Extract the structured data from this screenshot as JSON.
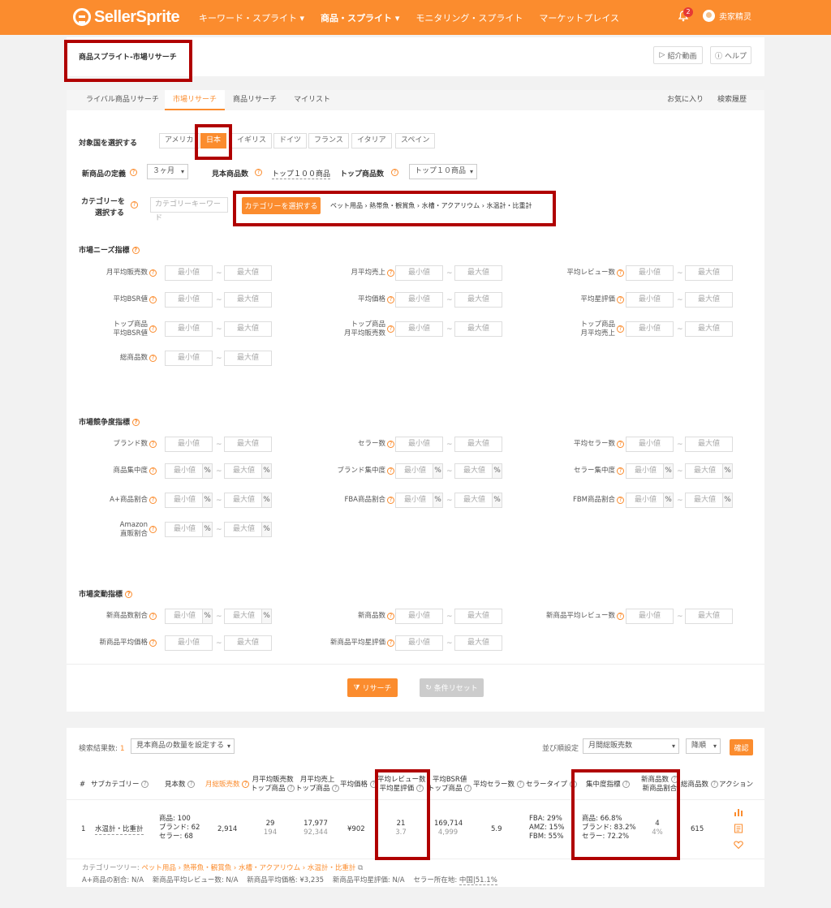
{
  "header": {
    "logo": "SellerSprite",
    "nav": [
      "キーワード・スプライト",
      "商品・スプライト",
      "モニタリング・スプライト",
      "マーケットプレイス"
    ],
    "notification_count": "2",
    "user_name": "卖家精灵"
  },
  "page": {
    "title": "商品スプライト-市場リサーチ",
    "intro_video": "紹介動画",
    "help": "ヘルプ"
  },
  "tabs": [
    "ライバル商品リサーチ",
    "市場リサーチ",
    "商品リサーチ",
    "マイリスト"
  ],
  "tabs_right": [
    "お気に入り",
    "検索履歴"
  ],
  "filters": {
    "country_label": "対象国を選択する",
    "countries": [
      "アメリカ",
      "日本",
      "イギリス",
      "ドイツ",
      "フランス",
      "イタリア",
      "スペイン"
    ],
    "new_product_label": "新商品の定義",
    "new_product_value": "３ヶ月",
    "sample_label": "見本商品数",
    "sample_value": "トップ１００商品",
    "top_label": "トップ商品数",
    "top_value": "トップ１０商品",
    "category_label_1": "カテゴリーを",
    "category_label_2": "選択する",
    "category_keyword_placeholder": "カテゴリーキーワード",
    "category_button": "カテゴリーを選択する",
    "category_path": "ペット用品 › 熱帯魚・観賞魚 › 水槽・アクアリウム › 水温計・比重計",
    "min": "最小値",
    "max": "最大値",
    "tilde": "~",
    "percent": "%"
  },
  "sections": {
    "demand": "市場ニーズ指標",
    "competition": "市場競争度指標",
    "change": "市場変動指標"
  },
  "demand_fields": {
    "c1": [
      "月平均販売数",
      "平均BSR値",
      "トップ商品\n平均BSR値",
      "総商品数"
    ],
    "c2": [
      "月平均売上",
      "平均価格",
      "トップ商品\n月平均販売数"
    ],
    "c3": [
      "平均レビュー数",
      "平均星評価",
      "トップ商品\n月平均売上"
    ]
  },
  "competition_fields": {
    "c1": [
      "ブランド数",
      "商品集中度",
      "A+商品割合",
      "Amazon\n直販割合"
    ],
    "c2": [
      "セラー数",
      "ブランド集中度",
      "FBA商品割合"
    ],
    "c3": [
      "平均セラー数",
      "セラー集中度",
      "FBM商品割合"
    ]
  },
  "change_fields": {
    "c1": [
      "新商品数割合",
      "新商品平均価格"
    ],
    "c2": [
      "新商品数",
      "新商品平均星評価"
    ],
    "c3": [
      "新商品平均レビュー数"
    ]
  },
  "actions": {
    "search": "リサーチ",
    "reset": "条件リセット"
  },
  "results": {
    "count_label": "検索結果数:",
    "count": "1",
    "sample_select": "見本商品の数量を設定する",
    "sort_label": "並び順設定",
    "sort_value": "月間総販売数",
    "order_value": "降順",
    "confirm": "確認"
  },
  "table": {
    "headers": {
      "num": "#",
      "subcat": "サブカテゴリー",
      "sample": "見本数",
      "monthly_total": "月総販売数",
      "monthly_avg_1": "月平均販売数",
      "monthly_avg_2": "トップ商品",
      "revenue_1": "月平均売上",
      "revenue_2": "トップ商品",
      "price": "平均価格",
      "review_1": "平均レビュー数",
      "review_2": "平均星評価",
      "bsr_1": "平均BSR値",
      "bsr_2": "トップ商品",
      "sellers": "平均セラー数",
      "seller_type": "セラータイプ",
      "concentration": "集中度指標",
      "new_1": "新商品数",
      "new_2": "新商品割合",
      "total": "総商品数",
      "action": "アクション"
    },
    "row": {
      "num": "1",
      "subcat": "水温計・比重計",
      "sample_products": "商品: 100",
      "sample_brands": "ブランド: 62",
      "sample_sellers": "セラー: 68",
      "monthly_total": "2,914",
      "monthly_avg": "29",
      "monthly_avg_top": "194",
      "revenue": "17,977",
      "revenue_top": "92,344",
      "price": "¥902",
      "reviews": "21",
      "rating": "3.7",
      "bsr": "169,714",
      "bsr_top": "4,999",
      "sellers": "5.9",
      "fba": "FBA: 29%",
      "amz": "AMZ: 15%",
      "fbm": "FBM: 55%",
      "conc_products": "商品: 66.8%",
      "conc_brands": "ブランド: 83.2%",
      "conc_sellers": "セラー: 72.2%",
      "new_count": "4",
      "new_ratio": "4%",
      "total": "615"
    },
    "footer": {
      "tree_label": "カテゴリーツリー:",
      "tree_path": "ペット用品 › 熱帯魚・観賞魚 › 水槽・アクアリウム › 水温計・比重計",
      "aplus": "A+商品の割合: N/A",
      "new_reviews": "新商品平均レビュー数: N/A",
      "new_price": "新商品平均価格: ¥3,235",
      "new_rating": "新商品平均星評価: N/A",
      "seller_loc": "セラー所在地:",
      "seller_loc_value": "中国|51.1%"
    }
  },
  "colors": {
    "accent": "#fb8c2e",
    "highlight": "#b00000"
  }
}
